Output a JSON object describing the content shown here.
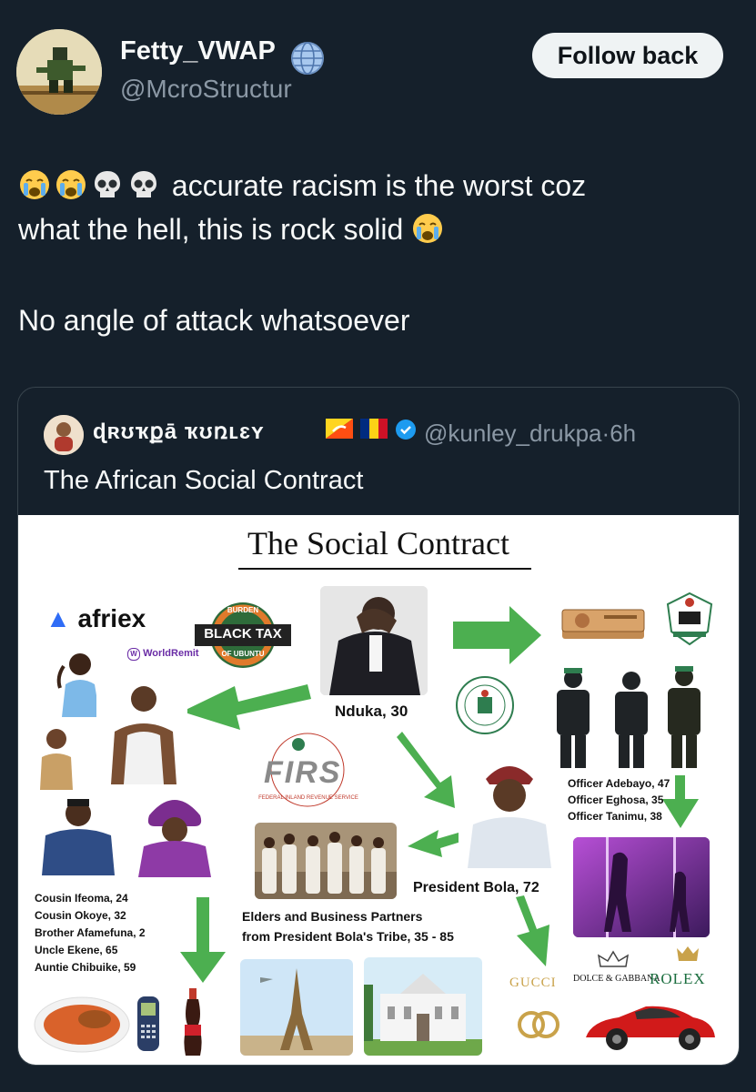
{
  "tweet": {
    "author_name": "Fetty_VWAP",
    "handle": "@McroStructur",
    "follow_label": "Follow back",
    "line1": "accurate racism is the worst coz",
    "line2": "what the hell, this is rock solid",
    "line3": "No angle of attack whatsoever"
  },
  "quote": {
    "author_name": "ɖʀʊҡքā ҡʊռʟɛʏ",
    "handle": "@kunley_drukpa",
    "time": "6h",
    "separator": "·",
    "text": "The African Social Contract"
  },
  "infographic": {
    "title": "The Social Contract",
    "afriex": "afriex",
    "worldremit": "WorldRemit",
    "black_tax": "BLACK TAX",
    "black_tax_top": "BURDEN",
    "black_tax_bottom": "OF UBUNTU",
    "nduka": "Nduka, 30",
    "firs": "FIRS",
    "firs_ring": "FEDERAL INLAND REVENUE SERVICE",
    "officers": [
      "Officer Adebayo, 47",
      "Officer Eghosa, 35",
      "Officer Tanimu, 38"
    ],
    "president": "President Bola, 72",
    "elders_line1": "Elders and Business Partners",
    "elders_line2": "from President Bola's Tribe, 35 - 85",
    "family": [
      "Cousin Ifeoma, 24",
      "Cousin Okoye, 32",
      "Brother Afamefuna, 2",
      "Uncle Ekene, 65",
      "Auntie Chibuike, 59"
    ],
    "gucci": "GUCCI",
    "dolce": "DOLCE & GABBANA",
    "rolex": "ROLEX"
  },
  "colors": {
    "background": "#15202b",
    "text": "#f7f9f9",
    "muted": "#8b98a5",
    "arrow": "#4caf50",
    "border": "#38444d"
  }
}
